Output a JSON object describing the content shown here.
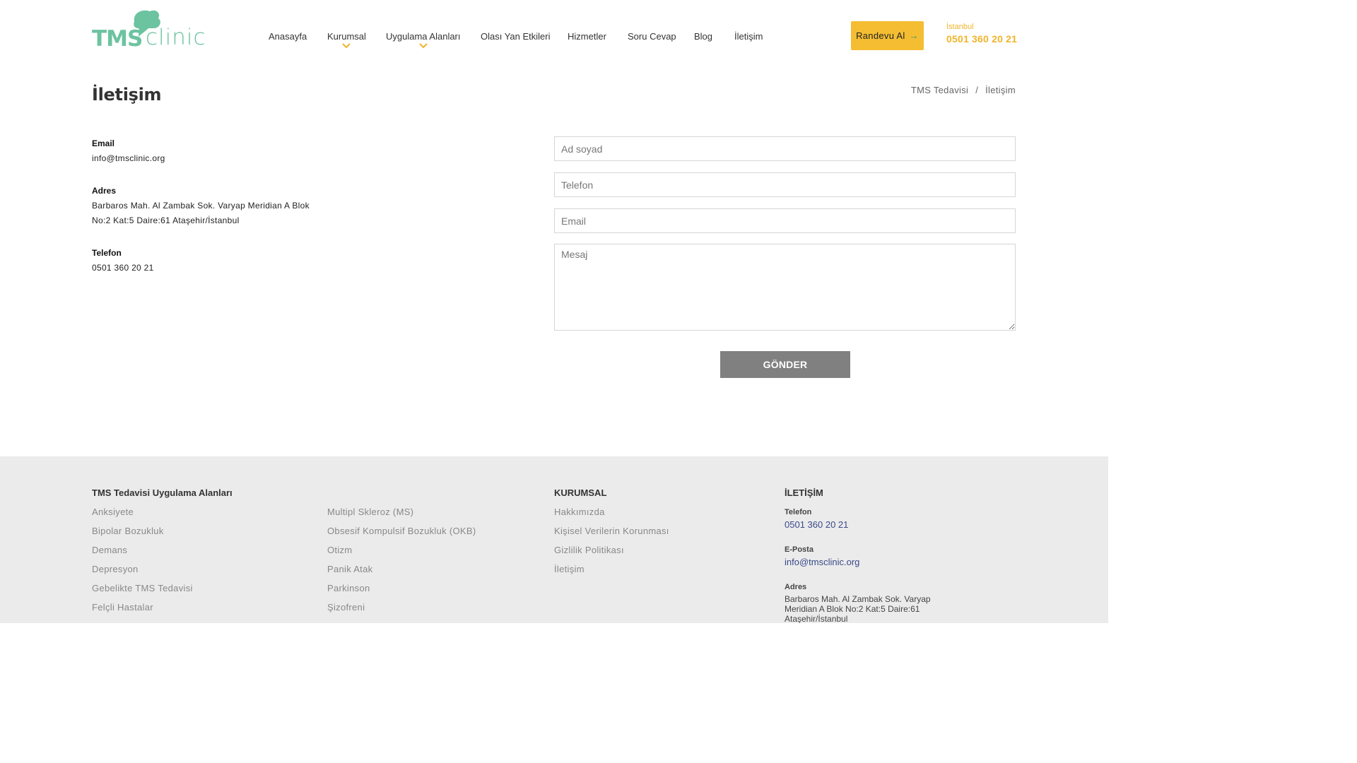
{
  "logo": {
    "part1": "TMS",
    "part2": "clinic"
  },
  "nav": [
    {
      "label": "Anasayfa",
      "dropdown": false
    },
    {
      "label": "Kurumsal",
      "dropdown": true
    },
    {
      "label": "Uygulama Alanları",
      "dropdown": true
    },
    {
      "label": "Olası Yan Etkileri",
      "dropdown": false
    },
    {
      "label": "Hizmetler",
      "dropdown": false
    },
    {
      "label": "Soru Cevap",
      "dropdown": false
    },
    {
      "label": "Blog",
      "dropdown": false
    },
    {
      "label": "İletişim",
      "dropdown": false
    }
  ],
  "cta": {
    "label": "Randevu Al",
    "arrow": "→"
  },
  "header_phone": {
    "city": "İstanbul",
    "number": "0501 360 20 21"
  },
  "page": {
    "title": "İletişim",
    "breadcrumb": [
      "TMS Tedavisi",
      "İletişim"
    ],
    "breadcrumb_sep": "/"
  },
  "contact": {
    "email_label": "Email",
    "email": "info@tmsclinic.org",
    "address_label": "Adres",
    "address_line1": "Barbaros Mah. Al Zambak Sok. Varyap Meridian A Blok",
    "address_line2": "No:2 Kat:5 Daire:61 Ataşehir/İstanbul",
    "phone_label": "Telefon",
    "phone": "0501 360 20 21"
  },
  "form": {
    "name_placeholder": "Ad soyad",
    "phone_placeholder": "Telefon",
    "email_placeholder": "Email",
    "message_placeholder": "Mesaj",
    "submit_label": "GÖNDER"
  },
  "footer": {
    "areas_heading": "TMS Tedavisi Uygulama Alanları",
    "areas_col1": [
      "Anksiyete",
      "Bipolar Bozukluk",
      "Demans",
      "Depresyon",
      "Gebelikte TMS Tedavisi",
      "Felçli Hastalar"
    ],
    "areas_col2": [
      "Multipl Skleroz (MS)",
      "Obsesif Kompulsif Bozukluk (OKB)",
      "Otizm",
      "Panik Atak",
      "Parkinson",
      "Şizofreni"
    ],
    "corporate_heading": "KURUMSAL",
    "corporate_links": [
      "Hakkımızda",
      "Kişisel Verilerin Korunması",
      "Gizlilik Politikası",
      "İletişim"
    ],
    "contact_heading": "İLETİŞİM",
    "phone_label": "Telefon",
    "phone": "0501 360 20 21",
    "email_label": "E-Posta",
    "email": "info@tmsclinic.org",
    "address_label": "Adres",
    "address": "Barbaros Mah. Al Zambak Sok. Varyap Meridian A Blok No:2 Kat:5 Daire:61 Ataşehir/İstanbul"
  },
  "colors": {
    "brand_green": "#6cc3a0",
    "accent_yellow": "#f4bd32",
    "phone_orange": "#f0b429",
    "button_gray": "#808080",
    "footer_bg": "#ebebeb"
  },
  "icons": {
    "logo_mark": "brain-icon",
    "dropdown": "chevron-down-icon",
    "cta_arrow": "arrow-right-icon"
  }
}
